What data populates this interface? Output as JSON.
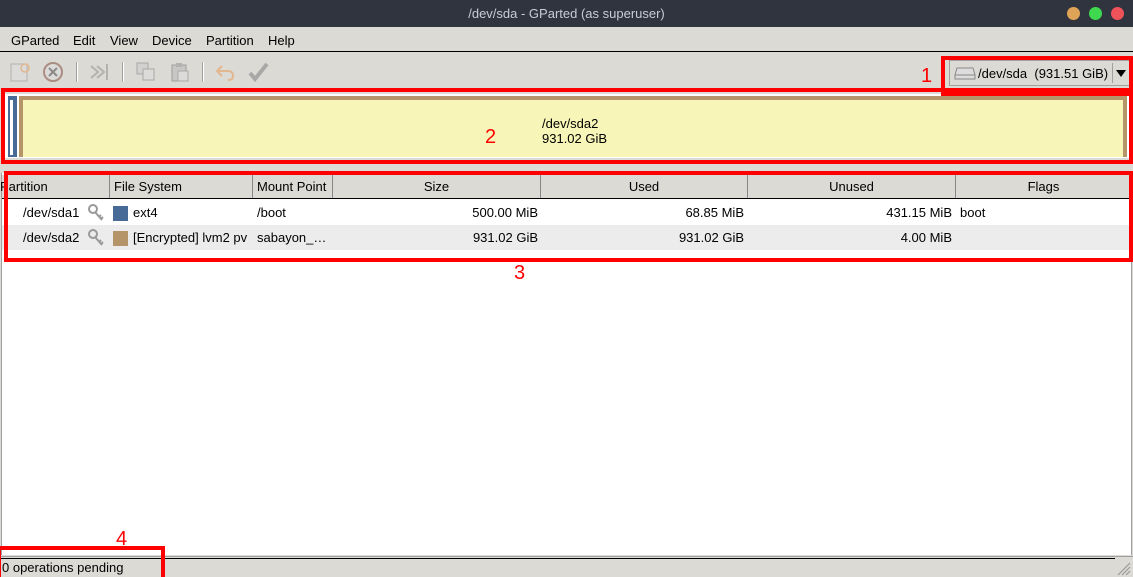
{
  "window": {
    "title": "/dev/sda - GParted (as superuser)",
    "controls": [
      "minimize",
      "maximize",
      "close"
    ]
  },
  "menubar": {
    "items": [
      "GParted",
      "Edit",
      "View",
      "Device",
      "Partition",
      "Help"
    ]
  },
  "toolbar": {
    "buttons": [
      {
        "icon": "new-partition-icon",
        "label": "New"
      },
      {
        "icon": "delete-icon",
        "label": "Delete"
      },
      {
        "icon": "resize-move-icon",
        "label": "Resize/Move"
      },
      {
        "icon": "copy-icon",
        "label": "Copy"
      },
      {
        "icon": "paste-icon",
        "label": "Paste"
      },
      {
        "icon": "undo-icon",
        "label": "Undo"
      },
      {
        "icon": "apply-icon",
        "label": "Apply"
      }
    ]
  },
  "device_selector": {
    "icon": "hard-drive-icon",
    "device": "/dev/sda",
    "size": "(931.51 GiB)",
    "label": "/dev/sda  (931.51 GiB)"
  },
  "disk_map": {
    "partitions": [
      {
        "name": "/dev/sda1",
        "color": "#476a97"
      },
      {
        "name": "/dev/sda2",
        "size": "931.02 GiB",
        "color": "#b49468",
        "fill": "#f7f5b7"
      }
    ]
  },
  "annotations": {
    "labels": [
      "1",
      "2",
      "3",
      "4"
    ],
    "color": "#ff0000"
  },
  "partition_table": {
    "columns": [
      "Partition",
      "File System",
      "Mount Point",
      "Size",
      "Used",
      "Unused",
      "Flags"
    ],
    "rows": [
      {
        "partition": "/dev/sda1",
        "fs_color": "#476a97",
        "file_system": "ext4",
        "mount_point": "/boot",
        "size": "500.00 MiB",
        "used": "68.85 MiB",
        "unused": "431.15 MiB",
        "flags": "boot"
      },
      {
        "partition": "/dev/sda2",
        "fs_color": "#b49468",
        "file_system": "[Encrypted] lvm2 pv",
        "mount_point": "sabayon_…",
        "size": "931.02 GiB",
        "used": "931.02 GiB",
        "unused": "4.00 MiB",
        "flags": ""
      }
    ]
  },
  "statusbar": {
    "text": "0 operations pending"
  }
}
